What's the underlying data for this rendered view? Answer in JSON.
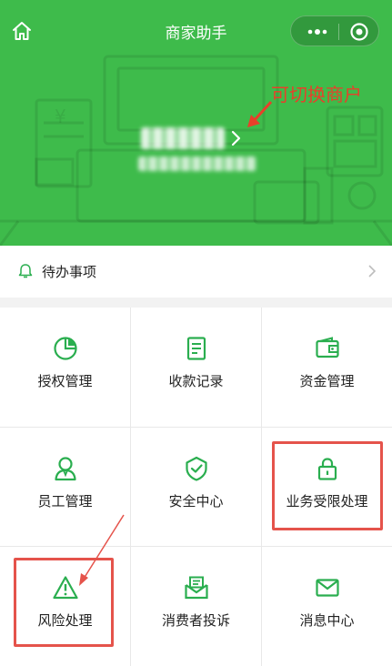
{
  "header": {
    "title": "商家助手",
    "annotation": "可切换商户"
  },
  "todo": {
    "label": "待办事项"
  },
  "grid": {
    "items": [
      {
        "label": "授权管理",
        "icon": "pie-chart-icon"
      },
      {
        "label": "收款记录",
        "icon": "document-list-icon"
      },
      {
        "label": "资金管理",
        "icon": "wallet-icon"
      },
      {
        "label": "员工管理",
        "icon": "person-icon"
      },
      {
        "label": "安全中心",
        "icon": "shield-check-icon"
      },
      {
        "label": "业务受限处理",
        "icon": "lock-icon"
      },
      {
        "label": "风险处理",
        "icon": "warning-triangle-icon"
      },
      {
        "label": "消费者投诉",
        "icon": "mail-open-icon"
      },
      {
        "label": "消息中心",
        "icon": "envelope-icon"
      }
    ]
  },
  "colors": {
    "brand_green": "#3ebb4b",
    "icon_green": "#2aae4f",
    "annotation_red": "#e8402a",
    "highlight_red": "#e5534b"
  }
}
